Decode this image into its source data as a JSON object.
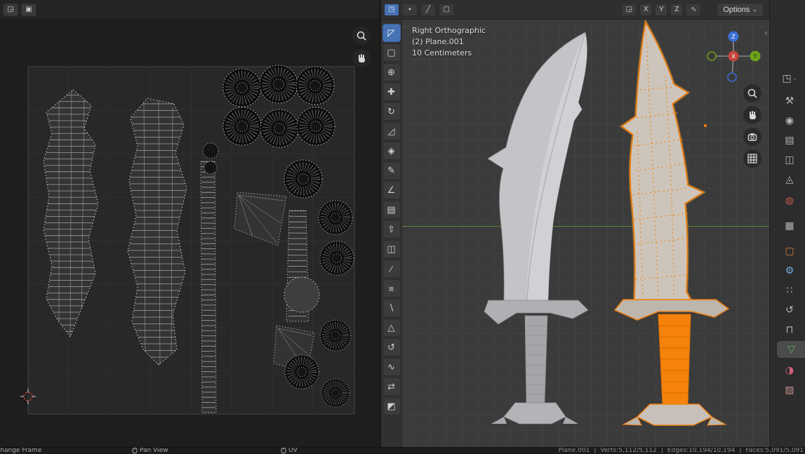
{
  "viewport": {
    "overlay": {
      "view": "Right Orthographic",
      "object": "(2) Plane.001",
      "scale": "10 Centimeters"
    },
    "header": {
      "axis_buttons": [
        "X",
        "Y",
        "Z"
      ],
      "options_label": "Options",
      "caret": "⌄",
      "collapse_chevron": "‹"
    },
    "gizmo": {
      "z": "Z",
      "y": "Y",
      "x": "X"
    }
  },
  "toolbar": {
    "tools": [
      {
        "name": "tweak",
        "glyph": "◸"
      },
      {
        "name": "select-box",
        "glyph": "▢"
      },
      {
        "name": "cursor",
        "glyph": "⊕"
      },
      {
        "name": "move",
        "glyph": "✚"
      },
      {
        "name": "rotate",
        "glyph": "↻"
      },
      {
        "name": "scale",
        "glyph": "◿"
      },
      {
        "name": "transform",
        "glyph": "◈"
      },
      {
        "name": "annotate",
        "glyph": "✎"
      },
      {
        "name": "measure",
        "glyph": "∠"
      },
      {
        "name": "add-cube",
        "glyph": "▤"
      },
      {
        "name": "extrude-region",
        "glyph": "⇧"
      },
      {
        "name": "inset-faces",
        "glyph": "◫"
      },
      {
        "name": "bevel",
        "glyph": "∕"
      },
      {
        "name": "loop-cut",
        "glyph": "≡"
      },
      {
        "name": "knife",
        "glyph": "∖"
      },
      {
        "name": "poly-build",
        "glyph": "△"
      },
      {
        "name": "spin",
        "glyph": "↺"
      },
      {
        "name": "smooth",
        "glyph": "∿"
      },
      {
        "name": "edge-slide",
        "glyph": "⇄"
      },
      {
        "name": "shear",
        "glyph": "◩"
      }
    ]
  },
  "properties_tabs": {
    "tabs": [
      {
        "name": "editor-type",
        "glyph": "◳",
        "color": "#b8b8b8"
      },
      {
        "name": "tool",
        "glyph": "⚒",
        "color": "#b8b8b8"
      },
      {
        "name": "render",
        "glyph": "◉",
        "color": "#b8b8b8"
      },
      {
        "name": "output",
        "glyph": "▤",
        "color": "#b8b8b8"
      },
      {
        "name": "view-layer",
        "glyph": "◫",
        "color": "#b8b8b8"
      },
      {
        "name": "scene",
        "glyph": "◬",
        "color": "#b8b8b8"
      },
      {
        "name": "world",
        "glyph": "◍",
        "color": "#c4584a"
      },
      {
        "name": "collection",
        "glyph": "▦",
        "color": "#b8b8b8"
      },
      {
        "name": "object",
        "glyph": "▢",
        "color": "#e0833c"
      },
      {
        "name": "modifiers",
        "glyph": "⚙",
        "color": "#71a8dd"
      },
      {
        "name": "particles",
        "glyph": "∷",
        "color": "#b8b8b8"
      },
      {
        "name": "physics",
        "glyph": "↺",
        "color": "#b8b8b8"
      },
      {
        "name": "constraints",
        "glyph": "⊓",
        "color": "#b8b8b8"
      },
      {
        "name": "object-data",
        "glyph": "▽",
        "color": "#57b35f"
      },
      {
        "name": "material",
        "glyph": "◑",
        "color": "#d6607a"
      },
      {
        "name": "texture",
        "glyph": "▨",
        "color": "#c78f8f"
      }
    ]
  },
  "footer": {
    "hints": [
      {
        "label": "Change Frame"
      },
      {
        "label": "Pan View"
      },
      {
        "label": "UV"
      }
    ]
  },
  "status": {
    "object": "Plane.001",
    "verts": "Verts:5,112/5,112",
    "edges": "Edges:10,194/10,194",
    "faces": "Faces:5,091/5,091",
    "separator": "|"
  }
}
